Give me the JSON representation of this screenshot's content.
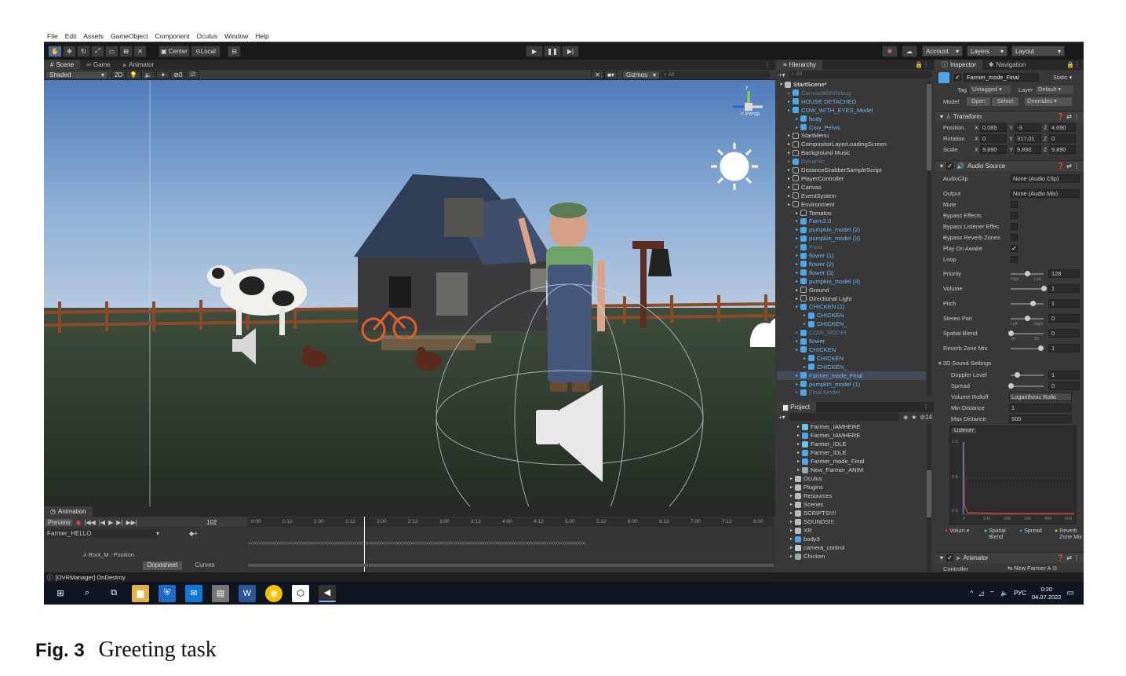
{
  "menu": [
    "File",
    "Edit",
    "Assets",
    "GameObject",
    "Component",
    "Oculus",
    "Window",
    "Help"
  ],
  "toolbar": {
    "center": "Center",
    "local": "Local",
    "account": "Account",
    "layers": "Layers",
    "layout": "Layout"
  },
  "scene_tabs": {
    "scene": "Scene",
    "game": "Game",
    "animator": "Animator"
  },
  "scene_toolbar": {
    "shaded": "Shaded",
    "mode2d": "2D",
    "gizmos": "Gizmos",
    "search": "All",
    "hidden_count": "0"
  },
  "scene_gizmo": {
    "persp": "< Persp",
    "axis_y": "y"
  },
  "hierarchy": {
    "title": "Hierarchy",
    "search": "All",
    "items": [
      {
        "label": "StartScene*",
        "depth": 0,
        "type": "scene"
      },
      {
        "label": "CanvasWithDebug",
        "depth": 1,
        "type": "dim"
      },
      {
        "label": "HOUSE DETACHED",
        "depth": 1,
        "type": "blue"
      },
      {
        "label": "COW_WITH_EYES_Model",
        "depth": 1,
        "type": "blue"
      },
      {
        "label": "body",
        "depth": 2,
        "type": "blue"
      },
      {
        "label": "Cow_Pelvis",
        "depth": 2,
        "type": "blue"
      },
      {
        "label": "StartMenu",
        "depth": 1,
        "type": "go"
      },
      {
        "label": "CompositorLayerLoadingScreen",
        "depth": 1,
        "type": "go"
      },
      {
        "label": "Background Music",
        "depth": 1,
        "type": "go"
      },
      {
        "label": "Dynamic",
        "depth": 1,
        "type": "dim"
      },
      {
        "label": "DistanceGrabberSampleScript",
        "depth": 1,
        "type": "go"
      },
      {
        "label": "PlayerController",
        "depth": 1,
        "type": "go"
      },
      {
        "label": "Canvas",
        "depth": 1,
        "type": "go"
      },
      {
        "label": "EventSystem",
        "depth": 1,
        "type": "go"
      },
      {
        "label": "Environment",
        "depth": 1,
        "type": "go"
      },
      {
        "label": "Tomatos",
        "depth": 2,
        "type": "go"
      },
      {
        "label": "Farm2.0",
        "depth": 2,
        "type": "blue"
      },
      {
        "label": "pumpkin_model (2)",
        "depth": 2,
        "type": "blue"
      },
      {
        "label": "pumpkin_model (3)",
        "depth": 2,
        "type": "blue"
      },
      {
        "label": "Point",
        "depth": 2,
        "type": "dim"
      },
      {
        "label": "flower (1)",
        "depth": 2,
        "type": "blue"
      },
      {
        "label": "flower (2)",
        "depth": 2,
        "type": "blue"
      },
      {
        "label": "flower (3)",
        "depth": 2,
        "type": "blue"
      },
      {
        "label": "pumpkin_model (4)",
        "depth": 2,
        "type": "blue"
      },
      {
        "label": "Ground",
        "depth": 2,
        "type": "go"
      },
      {
        "label": "Directional Light",
        "depth": 2,
        "type": "go"
      },
      {
        "label": "CHICKEN (1)",
        "depth": 2,
        "type": "blue"
      },
      {
        "label": "CHICKEN",
        "depth": 3,
        "type": "blue"
      },
      {
        "label": "CHICKEN_",
        "depth": 3,
        "type": "blue"
      },
      {
        "label": "COW_MODEL",
        "depth": 2,
        "type": "dim"
      },
      {
        "label": "flower",
        "depth": 2,
        "type": "blue"
      },
      {
        "label": "CHICKEN",
        "depth": 2,
        "type": "blue"
      },
      {
        "label": "CHICKEN",
        "depth": 3,
        "type": "blue"
      },
      {
        "label": "CHICKEN_",
        "depth": 3,
        "type": "blue"
      },
      {
        "label": "Farmer_mode_Final",
        "depth": 2,
        "type": "sel"
      },
      {
        "label": "pumpkin_model (1)",
        "depth": 2,
        "type": "blue"
      },
      {
        "label": "Final Model",
        "depth": 2,
        "type": "dim"
      }
    ]
  },
  "project": {
    "title": "Project",
    "count": "14",
    "items": [
      {
        "label": "Farmer_IAMHERE",
        "depth": 2,
        "type": "anim"
      },
      {
        "label": "Farmer_IAMHERE",
        "depth": 2,
        "type": "blue"
      },
      {
        "label": "Farmer_IDLE",
        "depth": 2,
        "type": "anim"
      },
      {
        "label": "Farmer_IDLE",
        "depth": 2,
        "type": "blue"
      },
      {
        "label": "Farmer_mode_Final",
        "depth": 2,
        "type": "blue"
      },
      {
        "label": "New_Farmer_ANIM",
        "depth": 2,
        "type": "ctrl"
      },
      {
        "label": "Oculus",
        "depth": 1,
        "type": "folder"
      },
      {
        "label": "Plugins",
        "depth": 1,
        "type": "folder"
      },
      {
        "label": "Resources",
        "depth": 1,
        "type": "folder"
      },
      {
        "label": "Scenes",
        "depth": 1,
        "type": "folder"
      },
      {
        "label": "SCRIPTS!!!!",
        "depth": 1,
        "type": "folder"
      },
      {
        "label": "SOUNDS!!!",
        "depth": 1,
        "type": "folder"
      },
      {
        "label": "XR",
        "depth": 1,
        "type": "folder"
      },
      {
        "label": "body3",
        "depth": 1,
        "type": "blue"
      },
      {
        "label": "camera_control",
        "depth": 1,
        "type": "file"
      },
      {
        "label": "Chicken",
        "depth": 1,
        "type": "ctrl"
      }
    ]
  },
  "inspector": {
    "tab": "Inspector",
    "nav_tab": "Navigation",
    "object_name": "Farmer_mode_Final",
    "static": "Static",
    "tag_label": "Tag",
    "tag": "Untagged",
    "layer_label": "Layer",
    "layer": "Default",
    "model_label": "Model",
    "open": "Open",
    "select": "Select",
    "overrides": "Overrides",
    "transform": {
      "title": "Transform",
      "position": {
        "label": "Position",
        "x": "0.085",
        "y": "-3",
        "z": "4.690"
      },
      "rotation": {
        "label": "Rotation",
        "x": "0",
        "y": "317.01",
        "z": "0"
      },
      "scale": {
        "label": "Scale",
        "x": "9.890",
        "y": "9.890",
        "z": "9.890"
      }
    },
    "audio_source": {
      "title": "Audio Source",
      "audio_clip": {
        "label": "AudioClip",
        "value": "None (Audio Clip)"
      },
      "output": {
        "label": "Output",
        "value": "None (Audio Mix)"
      },
      "mute": "Mute",
      "bypass_effects": "Bypass Effects",
      "bypass_listener": "Bypass Listener Effec",
      "bypass_reverb": "Bypass Reverb Zones",
      "play_on_awake": "Play On Awake",
      "loop": "Loop",
      "priority": {
        "label": "Priority",
        "value": "128",
        "min_label": "High",
        "max_label": "Low",
        "level": 0.5
      },
      "volume": {
        "label": "Volume",
        "value": "1",
        "level": 1.0
      },
      "pitch": {
        "label": "Pitch",
        "value": "1",
        "level": 0.67
      },
      "stereo_pan": {
        "label": "Stereo Pan",
        "value": "0",
        "min_label": "Left",
        "max_label": "Right",
        "level": 0.5
      },
      "spatial_blend": {
        "label": "Spatial Blend",
        "value": "0",
        "min_label": "2D",
        "max_label": "3D",
        "level": 0.0
      },
      "reverb_zone_mix": {
        "label": "Reverb Zone Mix",
        "value": "1",
        "level": 0.9
      },
      "settings_3d": "3D Sound Settings",
      "doppler": {
        "label": "Doppler Level",
        "value": "1",
        "level": 0.2
      },
      "spread": {
        "label": "Spread",
        "value": "0",
        "level": 0.0
      },
      "rolloff": {
        "label": "Volume Rolloff",
        "value": "Logarithmic Rollo"
      },
      "min_distance": {
        "label": "Min Distance",
        "value": "1"
      },
      "max_distance": {
        "label": "Max Distance",
        "value": "500"
      },
      "graph": {
        "listener": "Listener",
        "y_ticks": [
          "1.0",
          "0.5",
          "0.0"
        ],
        "x_ticks": [
          "0",
          "100",
          "200",
          "300",
          "400",
          "500"
        ],
        "legend": [
          "Volum e",
          "Spatial Blend",
          "Spread",
          "Reverb Zone Mix"
        ],
        "legend_colors": [
          "#d23b3b",
          "#5cc86a",
          "#3b8fe0",
          "#c9c23f"
        ]
      }
    },
    "animator": {
      "title": "Animator",
      "controller_label": "Controller",
      "controller": "New Farmer A"
    }
  },
  "animation": {
    "title": "Animation",
    "preview": "Preview",
    "frame": "102",
    "clip": "Farmer_HELLO",
    "property": "Root_M : Position",
    "timeline_ticks": [
      "0:00",
      "0:12",
      "1:00",
      "1:12",
      "2:00",
      "2:12",
      "3:00",
      "3:12",
      "4:00",
      "4:12",
      "5:00",
      "5:12",
      "6:00",
      "6:12",
      "7:00",
      "7:12",
      "8:00"
    ],
    "dopesheet": "Dopesheet",
    "curves": "Curves"
  },
  "status": "[OVRManager] OnDestroy",
  "taskbar": {
    "lang": "РУС",
    "time": "0:20",
    "date": "04.07.2022"
  },
  "caption": {
    "fig": "Fig. 3",
    "text": "Greeting task"
  }
}
